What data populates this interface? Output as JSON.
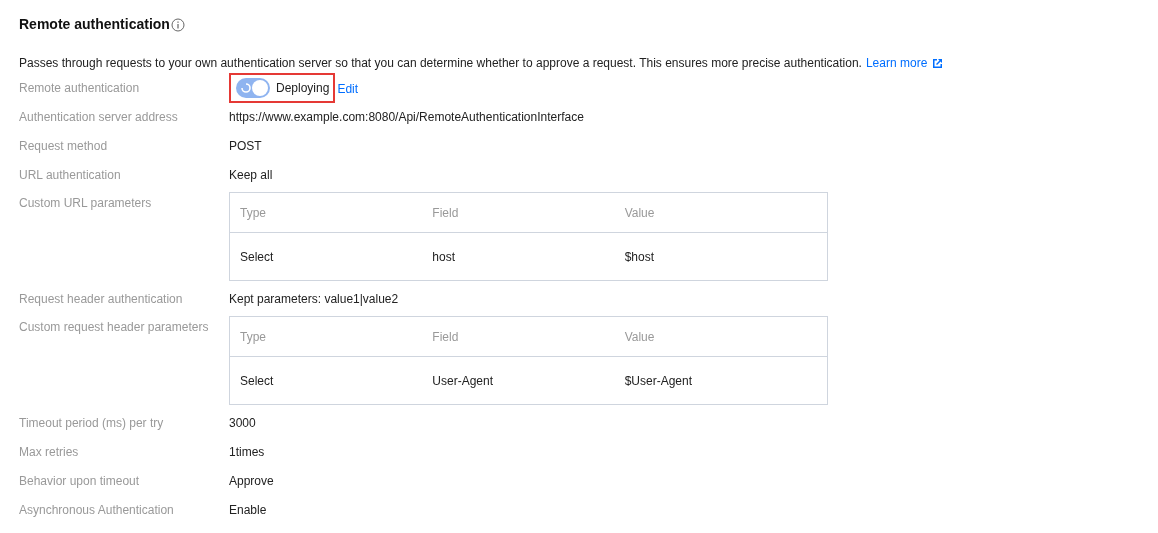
{
  "title": "Remote authentication",
  "description": "Passes through requests to your own authentication server so that you can determine whether to approve a request. This ensures more precise authentication.",
  "learn_more": "Learn more",
  "rows": [
    {
      "kind": "switch",
      "label": "Remote authentication",
      "on": true,
      "loading": true,
      "highlighted": true,
      "status": "Deploying",
      "action": "Edit"
    },
    {
      "kind": "text",
      "label": "Authentication server address",
      "value": "https://www.example.com:8080/Api/RemoteAuthenticationInterface"
    },
    {
      "kind": "text",
      "label": "Request method",
      "value": "POST"
    },
    {
      "kind": "text",
      "label": "URL authentication",
      "value": "Keep all"
    },
    {
      "kind": "table",
      "label": "Custom URL parameters",
      "columns": [
        "Type",
        "Field",
        "Value"
      ],
      "rows": [
        [
          "Select",
          "host",
          "$host"
        ]
      ]
    },
    {
      "kind": "text",
      "label": "Request header authentication",
      "value": "Kept parameters: value1|value2"
    },
    {
      "kind": "table",
      "label": "Custom request header parameters",
      "columns": [
        "Type",
        "Field",
        "Value"
      ],
      "rows": [
        [
          "Select",
          "User-Agent",
          "$User-Agent"
        ]
      ]
    },
    {
      "kind": "text",
      "label": "Timeout period (ms) per try",
      "value": "3000"
    },
    {
      "kind": "text",
      "label": "Max retries",
      "value": "1times"
    },
    {
      "kind": "text",
      "label": "Behavior upon timeout",
      "value": "Approve"
    },
    {
      "kind": "text",
      "label": "Asynchronous Authentication",
      "value": "Enable"
    }
  ]
}
